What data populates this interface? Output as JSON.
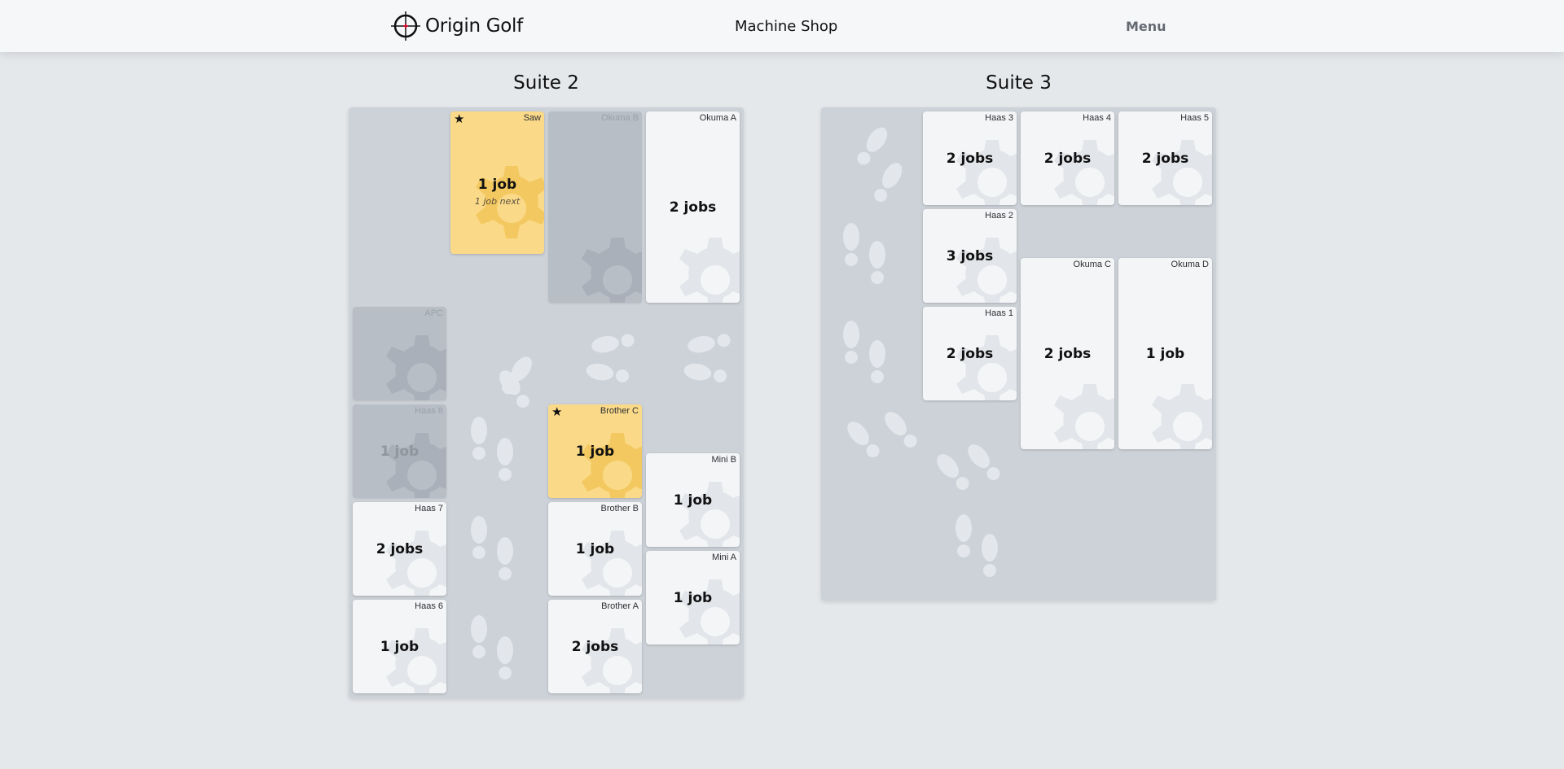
{
  "header": {
    "brand": "Origin Golf",
    "title": "Machine Shop",
    "menu_label": "Menu"
  },
  "colors": {
    "active_card": "#f4f5f7",
    "highlight_card": "#fada88",
    "inactive_card": "#b7bec6",
    "floor": "#ccd2d8"
  },
  "suite2": {
    "title": "Suite 2",
    "machines": {
      "saw": {
        "name": "Saw",
        "jobs": "1 job",
        "sub": "1 job next",
        "starred": true
      },
      "okuma_b": {
        "name": "Okuma B",
        "jobs": ""
      },
      "okuma_a": {
        "name": "Okuma A",
        "jobs": "2 jobs"
      },
      "apc": {
        "name": "APC",
        "jobs": ""
      },
      "haas_8": {
        "name": "Haas 8",
        "jobs": "1 job"
      },
      "brother_c": {
        "name": "Brother C",
        "jobs": "1 job",
        "starred": true
      },
      "mini_b": {
        "name": "Mini B",
        "jobs": "1 job"
      },
      "haas_7": {
        "name": "Haas 7",
        "jobs": "2 jobs"
      },
      "brother_b": {
        "name": "Brother B",
        "jobs": "1 job"
      },
      "mini_a": {
        "name": "Mini A",
        "jobs": "1 job"
      },
      "haas_6": {
        "name": "Haas 6",
        "jobs": "1 job"
      },
      "brother_a": {
        "name": "Brother A",
        "jobs": "2 jobs"
      }
    }
  },
  "suite3": {
    "title": "Suite 3",
    "machines": {
      "haas_3": {
        "name": "Haas 3",
        "jobs": "2 jobs"
      },
      "haas_4": {
        "name": "Haas 4",
        "jobs": "2 jobs"
      },
      "haas_5": {
        "name": "Haas 5",
        "jobs": "2 jobs"
      },
      "haas_2": {
        "name": "Haas 2",
        "jobs": "3 jobs"
      },
      "okuma_c": {
        "name": "Okuma C",
        "jobs": "2 jobs"
      },
      "okuma_d": {
        "name": "Okuma D",
        "jobs": "1 job"
      },
      "haas_1": {
        "name": "Haas 1",
        "jobs": "2 jobs"
      }
    }
  }
}
